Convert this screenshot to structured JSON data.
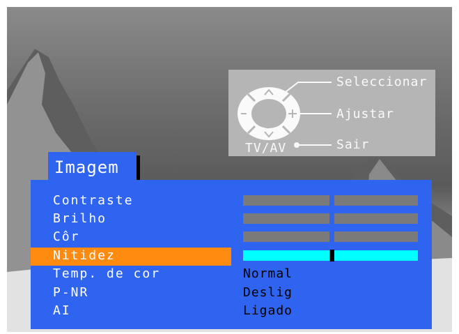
{
  "help": {
    "select": "Seleccionar",
    "adjust": "Ajustar",
    "exit": "Sair",
    "tvav": "TV/AV"
  },
  "menu": {
    "title": "Imagem",
    "items": [
      {
        "label": "Contraste",
        "type": "bar",
        "level": 0.5,
        "selected": false
      },
      {
        "label": "Brilho",
        "type": "bar",
        "level": 0.5,
        "selected": false
      },
      {
        "label": "Côr",
        "type": "bar",
        "level": 0.5,
        "selected": false
      },
      {
        "label": "Nitidez",
        "type": "bar",
        "level": 0.5,
        "selected": true
      },
      {
        "label": "Temp. de cor",
        "type": "text",
        "value": "Normal",
        "selected": false
      },
      {
        "label": "P-NR",
        "type": "text",
        "value": "Deslig",
        "selected": false
      },
      {
        "label": "AI",
        "type": "text",
        "value": "Ligado",
        "selected": false
      }
    ]
  },
  "colors": {
    "panel": "#2f64f0",
    "highlight": "#ff8a10",
    "active_bar": "#00ffff",
    "inactive_bar": "#7a7a7a"
  }
}
